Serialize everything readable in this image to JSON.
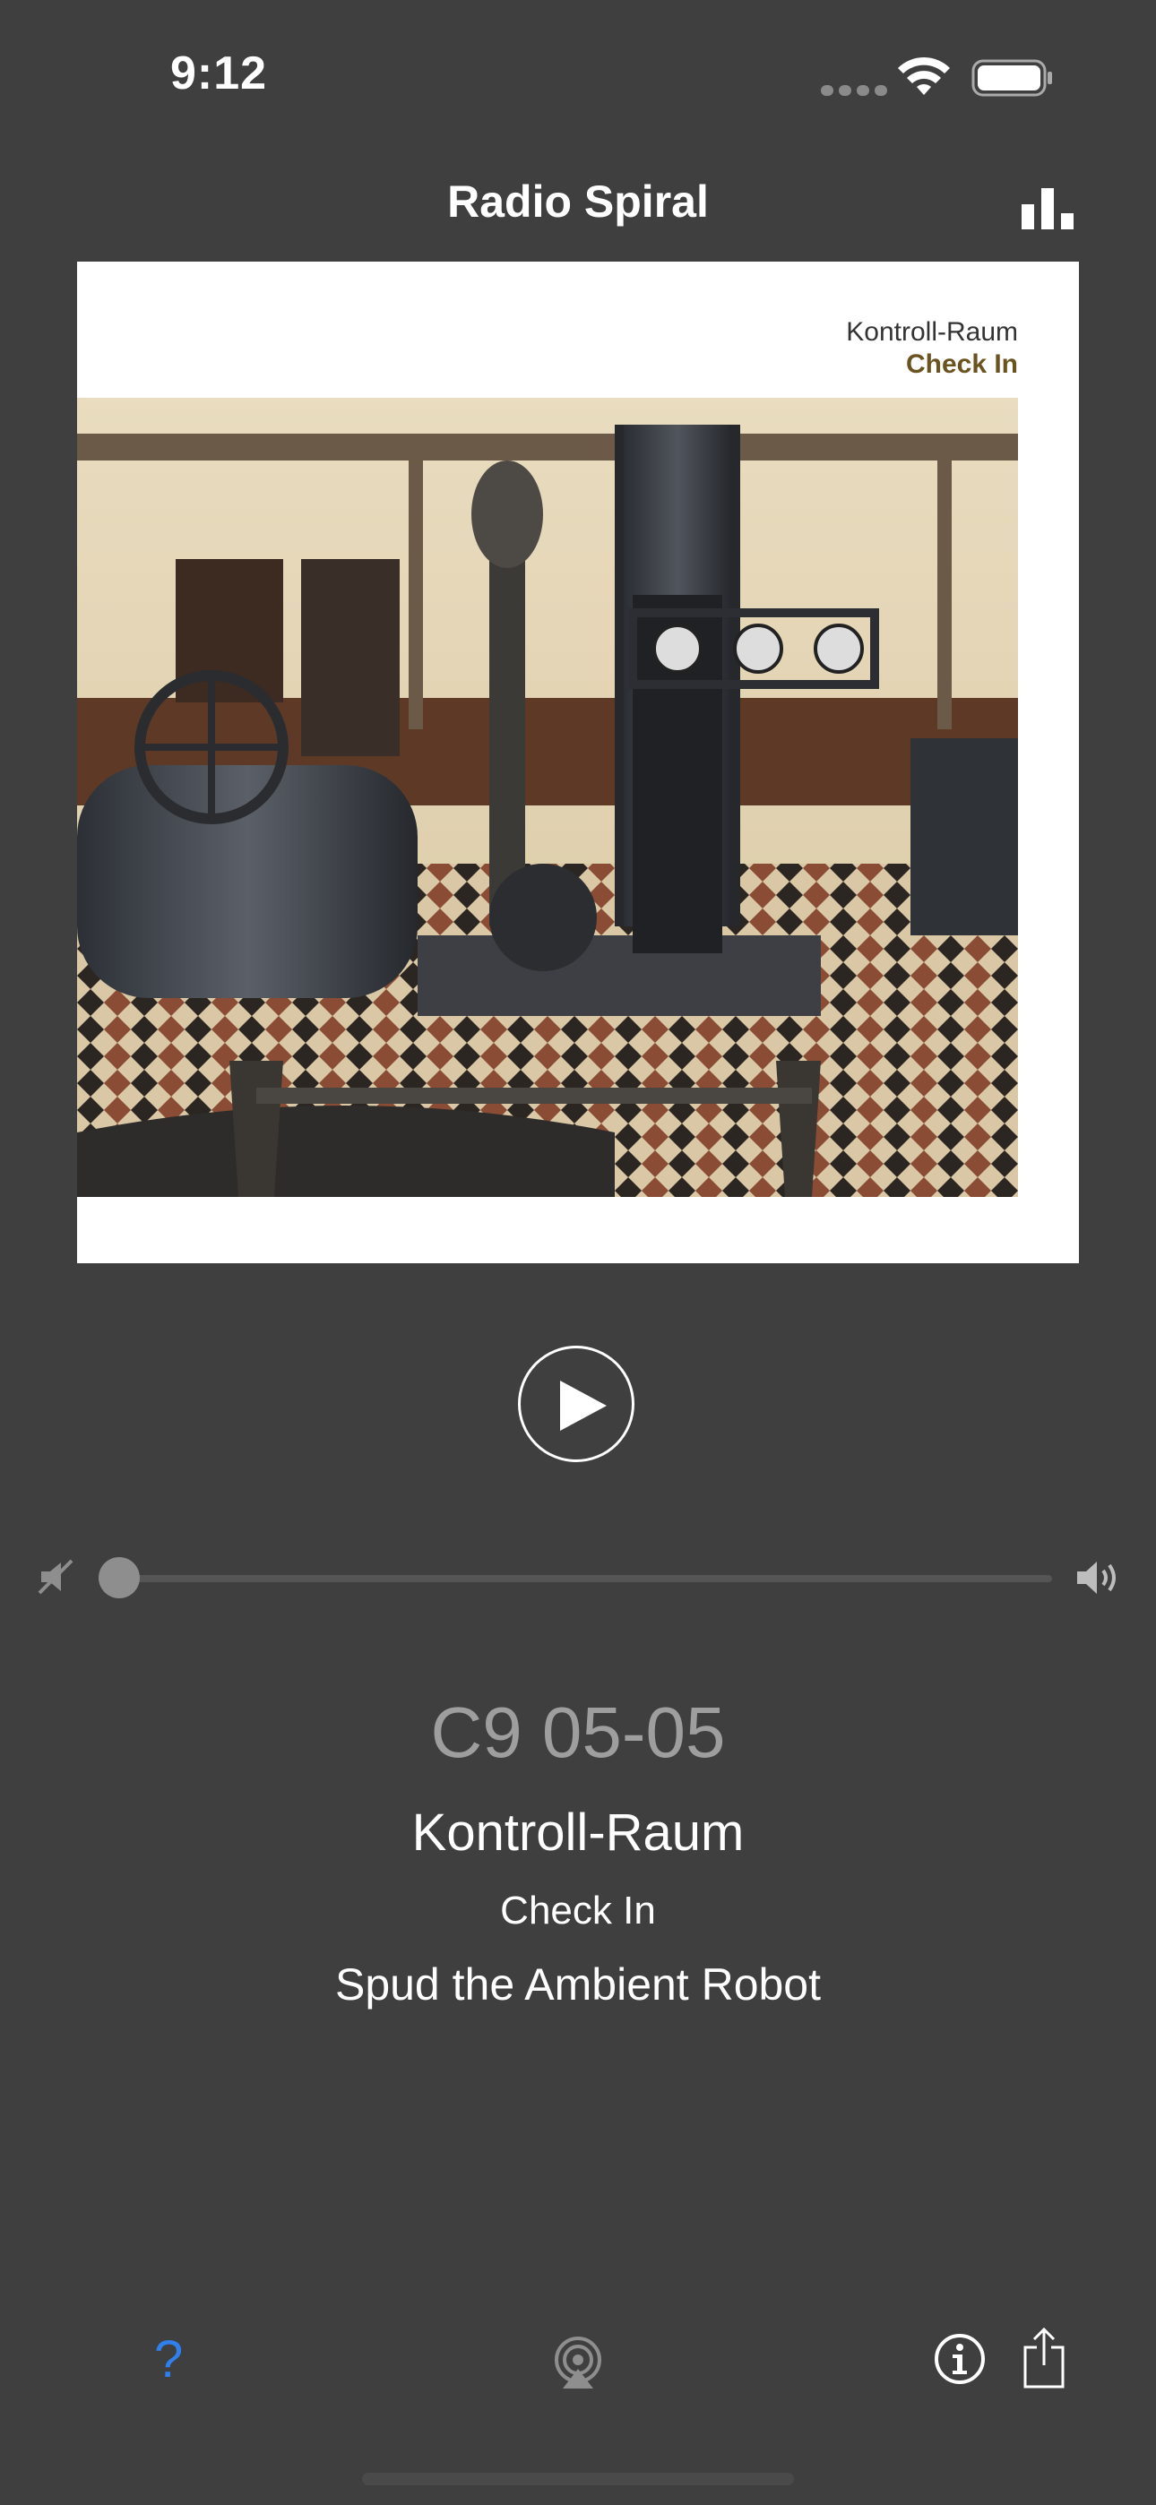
{
  "status_bar": {
    "time": "9:12",
    "icons": [
      "signal-icon",
      "wifi-icon",
      "battery-icon"
    ]
  },
  "nav": {
    "title": "Radio Spiral",
    "right_icon": "bars-chart-icon"
  },
  "album": {
    "artist": "Kontroll-Raum",
    "title": "Check In",
    "title_color": "#6b5320"
  },
  "player": {
    "state_icon": "play-icon",
    "volume_level": 0.0
  },
  "now_playing": {
    "show_code": "C9 05-05",
    "artist": "Kontroll-Raum",
    "track": "Check In",
    "dj": "Spud the Ambient Robot"
  },
  "toolbar": {
    "help_label": "?",
    "help_color": "#2f80ed",
    "icons": [
      "help-icon",
      "airplay-icon",
      "info-icon",
      "share-icon"
    ]
  },
  "colors": {
    "background": "#3f3f3f",
    "secondary_text": "#9e9e9e"
  }
}
